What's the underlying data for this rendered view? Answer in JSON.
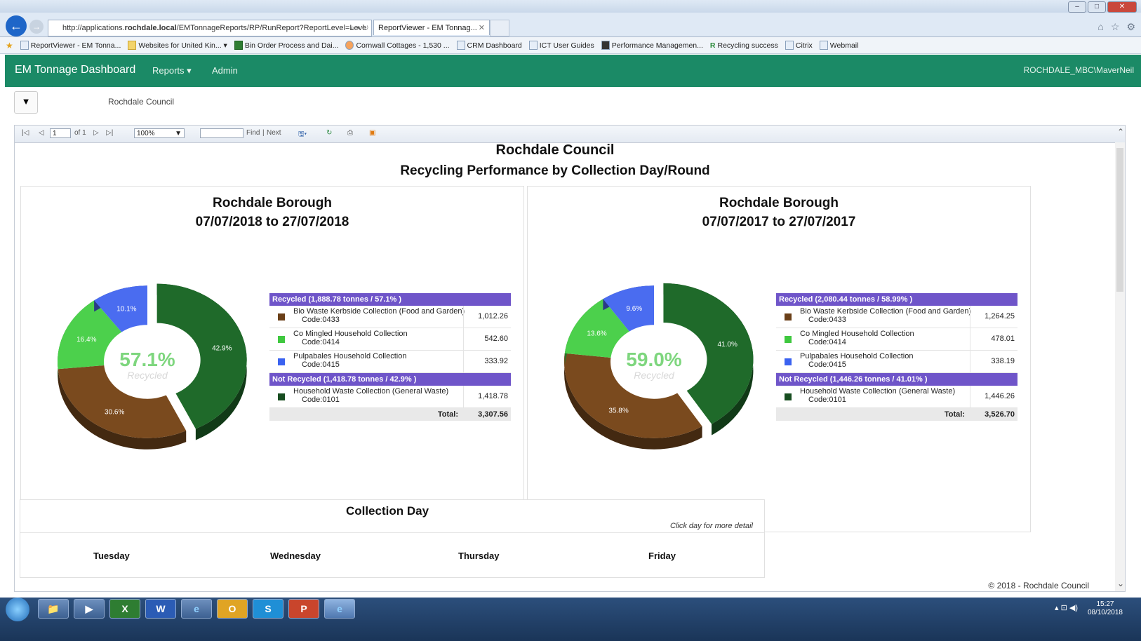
{
  "browser": {
    "url_prefix": "http://applications.",
    "url_domain": "rochdale.local",
    "url_path": "/EMTonnageReports/RP/RunReport?ReportLevel=Leve",
    "address_controls": "⌕ ▾ ↻",
    "tab_title": "ReportViewer - EM Tonnag...",
    "tab_close": "✕",
    "favorites": [
      "ReportViewer - EM Tonna...",
      "Websites for United Kin... ▾",
      "Bin Order Process and Dai...",
      "Cornwall Cottages - 1,530 ...",
      "CRM Dashboard",
      "ICT User Guides",
      "Performance Managemen...",
      "Recycling success",
      "Citrix",
      "Webmail"
    ],
    "icons": [
      "home-icon",
      "star-icon",
      "gear-icon"
    ]
  },
  "app": {
    "brand": "EM Tonnage Dashboard",
    "menu_reports": "Reports ▾",
    "menu_admin": "Admin",
    "user": "ROCHDALE_MBC\\MaverNeil",
    "filter_icon": "▼",
    "org_label": "Rochdale Council"
  },
  "viewer": {
    "page_value": "1",
    "page_of": "of 1",
    "zoom": "100%",
    "find": "Find",
    "sep": "|",
    "next": "Next",
    "report_title": "Rochdale Council",
    "report_subtitle": "Recycling Performance by Collection Day/Round"
  },
  "charts": [
    {
      "title": "Rochdale Borough",
      "dates": "07/07/2018 to 27/07/2018",
      "center_pct": "57.1%",
      "center_label": "Recycled",
      "recycled_header": "Recycled (1,888.78 tonnes / 57.1% )",
      "not_recycled_header": "Not Recycled (1,418.78 tonnes / 42.9% )",
      "rows_recycled": [
        {
          "name": "Bio Waste Kerbside Collection (Food and Garden)",
          "code": "Code:0433",
          "value": "1,012.26"
        },
        {
          "name": "Co Mingled Household Collection",
          "code": "Code:0414",
          "value": "542.60"
        },
        {
          "name": "Pulpabales Household Collection",
          "code": "Code:0415",
          "value": "333.92"
        }
      ],
      "rows_not_recycled": [
        {
          "name": "Household Waste Collection (General Waste)",
          "code": "Code:0101",
          "value": "1,418.78"
        }
      ],
      "total_label": "Total:",
      "total": "3,307.56"
    },
    {
      "title": "Rochdale Borough",
      "dates": "07/07/2017 to 27/07/2017",
      "center_pct": "59.0%",
      "center_label": "Recycled",
      "recycled_header": "Recycled (2,080.44 tonnes / 58.99% )",
      "not_recycled_header": "Not Recycled (1,446.26 tonnes / 41.01% )",
      "rows_recycled": [
        {
          "name": "Bio Waste Kerbside Collection (Food and Garden)",
          "code": "Code:0433",
          "value": "1,264.25"
        },
        {
          "name": "Co Mingled Household Collection",
          "code": "Code:0414",
          "value": "478.01"
        },
        {
          "name": "Pulpabales Household Collection",
          "code": "Code:0415",
          "value": "338.19"
        }
      ],
      "rows_not_recycled": [
        {
          "name": "Household Waste Collection (General Waste)",
          "code": "Code:0101",
          "value": "1,446.26"
        }
      ],
      "total_label": "Total:",
      "total": "3,526.70"
    }
  ],
  "chart_data": [
    {
      "type": "pie",
      "title": "Rochdale Borough",
      "subtitle": "07/07/2018 to 27/07/2018",
      "categories": [
        "Household Waste Collection (General Waste)",
        "Bio Waste Kerbside Collection (Food and Garden)",
        "Co Mingled Household Collection",
        "Pulpabales Household Collection"
      ],
      "values": [
        42.9,
        30.6,
        16.4,
        10.1
      ],
      "labels": [
        "42.9%",
        "30.6%",
        "16.4%",
        "10.1%"
      ],
      "colors": [
        "#1f6a2a",
        "#7a4a1e",
        "#4cd04c",
        "#4a6cf0"
      ]
    },
    {
      "type": "pie",
      "title": "Rochdale Borough",
      "subtitle": "07/07/2017 to 27/07/2017",
      "categories": [
        "Household Waste Collection (General Waste)",
        "Bio Waste Kerbside Collection (Food and Garden)",
        "Co Mingled Household Collection",
        "Pulpabales Household Collection"
      ],
      "values": [
        41.0,
        35.8,
        13.6,
        9.6
      ],
      "labels": [
        "41.0%",
        "35.8%",
        "13.6%",
        "9.6%"
      ],
      "colors": [
        "#1f6a2a",
        "#7a4a1e",
        "#4cd04c",
        "#4a6cf0"
      ]
    }
  ],
  "collection": {
    "title": "Collection Day",
    "hint": "Click day for more detail",
    "days": [
      "Tuesday",
      "Wednesday",
      "Thursday",
      "Friday"
    ]
  },
  "footer": "© 2018 - Rochdale Council",
  "taskbar": {
    "apps": [
      "📁",
      "▶",
      "X",
      "W",
      "e",
      "O",
      "S",
      "P",
      "e"
    ],
    "tray": "▴ ⊡ ◀)",
    "time": "15:27",
    "date": "08/10/2018"
  }
}
